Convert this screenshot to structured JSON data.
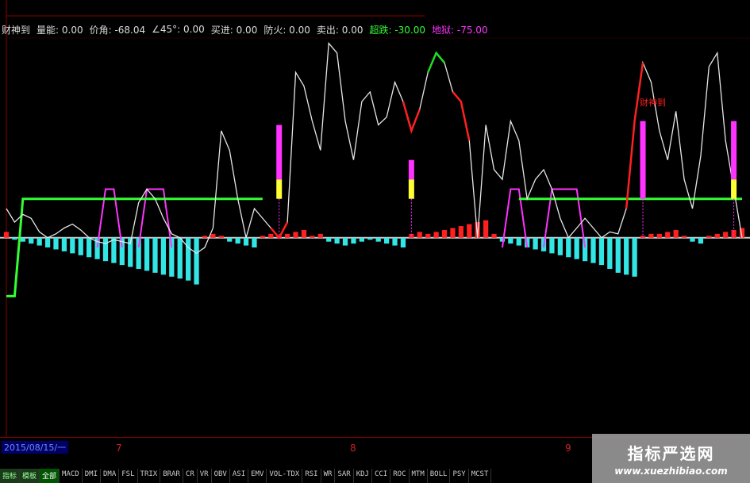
{
  "info": {
    "name": "财神到",
    "item1": "量能: 0.00",
    "item2": "价角: -68.04",
    "item3": "∠45°: 0.00",
    "item4": "买进: 0.00",
    "item5": "防火: 0.00",
    "item6": "卖出: 0.00",
    "item7": "超跌: -30.00",
    "item8": "地狱: -75.00"
  },
  "annotation": "财神到",
  "axis": {
    "date_label": "2015/08/15/一",
    "ticks": [
      "7",
      "8",
      "9"
    ]
  },
  "tabs": [
    "指标",
    "模板",
    "全部",
    "MACD",
    "DMI",
    "DMA",
    "FSL",
    "TRIX",
    "BRAR",
    "CR",
    "VR",
    "OBV",
    "ASI",
    "EMV",
    "VOL-TDX",
    "RSI",
    "WR",
    "SAR",
    "KDJ",
    "CCI",
    "ROC",
    "MTM",
    "BOLL",
    "PSY",
    "MCST"
  ],
  "watermark": {
    "title": "指标严选网",
    "url": "www.xuezhibiao.com"
  },
  "colors": {
    "white_line": "#e6e6e6",
    "red_segment": "#ff2020",
    "green_segment": "#22dd22",
    "green_level": "#33ff33",
    "magenta": "#ff33ff",
    "yellow": "#ffff33",
    "cyan": "#33e6e6",
    "red_bar": "#ff2020",
    "zero_line": "#cccccc"
  },
  "chart_data": {
    "type": "line",
    "title": "",
    "xlabel": "",
    "ylabel": "",
    "ylim": [
      -100,
      110
    ],
    "x": [
      0,
      1,
      2,
      3,
      4,
      5,
      6,
      7,
      8,
      9,
      10,
      11,
      12,
      13,
      14,
      15,
      16,
      17,
      18,
      19,
      20,
      21,
      22,
      23,
      24,
      25,
      26,
      27,
      28,
      29,
      30,
      31,
      32,
      33,
      34,
      35,
      36,
      37,
      38,
      39,
      40,
      41,
      42,
      43,
      44,
      45,
      46,
      47,
      48,
      49,
      50,
      51,
      52,
      53,
      54,
      55,
      56,
      57,
      58,
      59,
      60,
      61,
      62,
      63,
      64,
      65,
      66,
      67,
      68,
      69,
      70,
      71,
      72,
      73,
      74,
      75,
      76,
      77,
      78,
      79,
      80,
      81,
      82,
      83,
      84,
      85,
      86,
      87,
      88,
      89
    ],
    "series": [
      {
        "values": [
          15,
          8,
          12,
          10,
          3,
          0,
          2,
          5,
          7,
          4,
          0,
          -2,
          -3,
          -1,
          -2,
          -3,
          18,
          25,
          20,
          10,
          2,
          0,
          -5,
          -8,
          -5,
          5,
          55,
          45,
          20,
          0,
          15,
          10,
          5,
          0,
          8,
          85,
          78,
          60,
          45,
          100,
          95,
          60,
          40,
          70,
          75,
          58,
          62,
          80,
          70,
          55,
          66,
          85,
          95,
          90,
          75,
          70,
          50,
          0,
          58,
          35,
          30,
          60,
          50,
          20,
          30,
          35,
          25,
          10,
          0,
          5,
          10,
          5,
          0,
          3,
          2,
          15,
          60,
          90,
          80,
          55,
          40,
          65,
          30,
          15,
          42,
          88,
          95,
          50,
          25,
          0
        ],
        "segments": [
          {
            "color": "red",
            "range": [
              32,
              34
            ]
          },
          {
            "color": "red",
            "range": [
              48,
              50
            ]
          },
          {
            "color": "green",
            "range": [
              51,
              53
            ]
          },
          {
            "color": "red",
            "range": [
              54,
              56
            ]
          },
          {
            "color": "red",
            "range": [
              75,
              77
            ]
          }
        ]
      },
      {
        "values": [
          -30,
          -30,
          20,
          20,
          20,
          20,
          20,
          20,
          20,
          20,
          20,
          20,
          20,
          20,
          20,
          20,
          20,
          20,
          20,
          20,
          20,
          20,
          20,
          20,
          20,
          20,
          20,
          20,
          20,
          20,
          20,
          20,
          null,
          null,
          null,
          null,
          null,
          null,
          null,
          null,
          null,
          null,
          null,
          null,
          null,
          null,
          null,
          null,
          null,
          null,
          null,
          null,
          null,
          null,
          null,
          null,
          null,
          null,
          null,
          null,
          null,
          null,
          20,
          20,
          20,
          20,
          20,
          20,
          20,
          20,
          20,
          20,
          20,
          20,
          20,
          20,
          20,
          20,
          20,
          20,
          20,
          20,
          20,
          20,
          20,
          20,
          20,
          20,
          20,
          20
        ]
      }
    ],
    "histogram": [
      3,
      -1,
      -2,
      -3,
      -4,
      -5,
      -6,
      -7,
      -8,
      -9,
      -10,
      -11,
      -12,
      -13,
      -14,
      -15,
      -16,
      -17,
      -18,
      -19,
      -20,
      -21,
      -22,
      -24,
      1,
      2,
      1,
      -2,
      -3,
      -4,
      -5,
      1,
      2,
      1,
      2,
      3,
      4,
      1,
      2,
      -2,
      -3,
      -4,
      -3,
      -2,
      -1,
      -2,
      -3,
      -4,
      -5,
      2,
      3,
      2,
      3,
      4,
      5,
      6,
      7,
      8,
      9,
      2,
      -2,
      -3,
      -4,
      -5,
      -6,
      -7,
      -8,
      -9,
      -10,
      -11,
      -12,
      -13,
      -14,
      -16,
      -18,
      -19,
      -20,
      1,
      2,
      2,
      3,
      4,
      1,
      -2,
      -3,
      1,
      2,
      3,
      4,
      5
    ],
    "magenta_bumps": [
      [
        11,
        14,
        -5,
        5
      ],
      [
        16,
        20,
        -5,
        5
      ],
      [
        60,
        63,
        -5,
        5
      ],
      [
        65,
        70,
        -5,
        5
      ]
    ],
    "signal_bars": [
      {
        "x": 33,
        "top": 28,
        "mid": 10,
        "bottom": 0
      },
      {
        "x": 49,
        "top": 10,
        "mid": 10,
        "bottom": 0
      },
      {
        "x": 77,
        "top": 40,
        "mid": 0,
        "bottom": 0
      },
      {
        "x": 88,
        "top": 30,
        "mid": 10,
        "bottom": 0
      }
    ]
  }
}
